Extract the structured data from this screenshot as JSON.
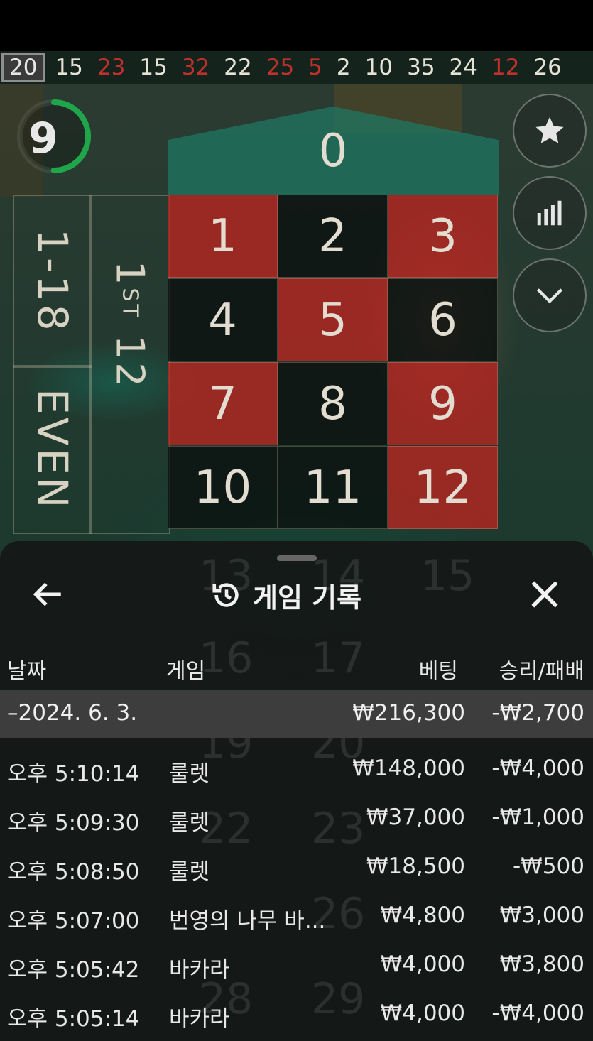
{
  "results_strip": {
    "items": [
      {
        "value": "20",
        "color": "highlight"
      },
      {
        "value": "15",
        "color": "black"
      },
      {
        "value": "23",
        "color": "red"
      },
      {
        "value": "15",
        "color": "black"
      },
      {
        "value": "32",
        "color": "red"
      },
      {
        "value": "22",
        "color": "black"
      },
      {
        "value": "25",
        "color": "red"
      },
      {
        "value": "5",
        "color": "red"
      },
      {
        "value": "2",
        "color": "black"
      },
      {
        "value": "10",
        "color": "black"
      },
      {
        "value": "35",
        "color": "black"
      },
      {
        "value": "24",
        "color": "black"
      },
      {
        "value": "12",
        "color": "red"
      },
      {
        "value": "26",
        "color": "black"
      }
    ]
  },
  "timer": {
    "value": "9",
    "color": "#1fa64a",
    "fraction_remaining": 0.5
  },
  "side_bets": {
    "low": "1-18",
    "even": "EVEN",
    "dozen_prefix": "1",
    "dozen_suffix": "ST",
    "dozen_num": "12"
  },
  "table": {
    "zero": "0",
    "cells": [
      {
        "n": "1",
        "color": "red"
      },
      {
        "n": "2",
        "color": "black"
      },
      {
        "n": "3",
        "color": "red"
      },
      {
        "n": "4",
        "color": "black"
      },
      {
        "n": "5",
        "color": "red"
      },
      {
        "n": "6",
        "color": "black"
      },
      {
        "n": "7",
        "color": "red"
      },
      {
        "n": "8",
        "color": "black"
      },
      {
        "n": "9",
        "color": "red"
      },
      {
        "n": "10",
        "color": "black"
      },
      {
        "n": "11",
        "color": "black"
      },
      {
        "n": "12",
        "color": "red"
      }
    ]
  },
  "right_buttons": [
    {
      "icon": "star-icon"
    },
    {
      "icon": "statistics-icon"
    },
    {
      "icon": "chevron-down-icon"
    }
  ],
  "history_sheet": {
    "title": "게임 기록",
    "title_icon": "history-icon",
    "back_icon": "back-arrow-icon",
    "close_icon": "close-icon",
    "columns": {
      "date": "날짜",
      "game": "게임",
      "bet": "베팅",
      "win_loss": "승리/패배"
    },
    "date_group": {
      "label": "–2024. 6. 3.",
      "bet": "₩216,300",
      "win_loss": "-₩2,700"
    },
    "rows": [
      {
        "time": "오후 5:10:14",
        "game": "룰렛",
        "bet": "₩148,000",
        "win_loss": "-₩4,000"
      },
      {
        "time": "오후 5:09:30",
        "game": "룰렛",
        "bet": "₩37,000",
        "win_loss": "-₩1,000"
      },
      {
        "time": "오후 5:08:50",
        "game": "룰렛",
        "bet": "₩18,500",
        "win_loss": "-₩500"
      },
      {
        "time": "오후 5:07:00",
        "game": "번영의 나무 바...",
        "bet": "₩4,800",
        "win_loss": "₩3,000"
      },
      {
        "time": "오후 5:05:42",
        "game": "바카라",
        "bet": "₩4,000",
        "win_loss": "₩3,800"
      },
      {
        "time": "오후 5:05:14",
        "game": "바카라",
        "bet": "₩4,000",
        "win_loss": "-₩4,000"
      }
    ]
  },
  "colors": {
    "red": "#c0302c",
    "green_felt": "#1e786a",
    "sheet_bg": "#141414",
    "date_row_bg": "#3d3d3d"
  }
}
